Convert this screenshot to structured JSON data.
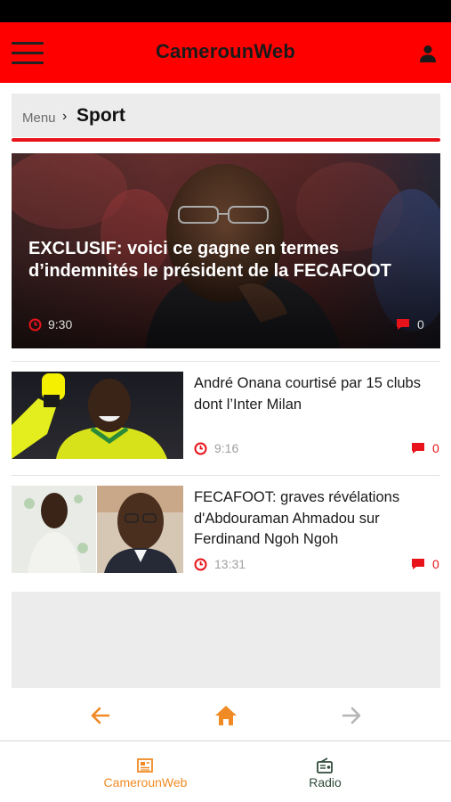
{
  "app": {
    "title": "CamerounWeb",
    "brand_color": "#ff0000",
    "accent_color": "#e8131a",
    "icons": [
      "hamburger-menu-icon",
      "user-icon",
      "clock-icon",
      "comment-icon",
      "arrow-left-icon",
      "home-icon",
      "arrow-right-icon",
      "newspaper-icon",
      "radio-icon"
    ]
  },
  "breadcrumb": {
    "menu_label": "Menu",
    "separator": "›",
    "current": "Sport"
  },
  "featured": {
    "title": "EXCLUSIF: voici ce gagne en termes d’indemnités le président de la FECAFOOT",
    "time": "9:30",
    "comments": "0"
  },
  "articles": [
    {
      "title": "André Onana courtisé par 15 clubs dont l’Inter Milan",
      "time": "9:16",
      "comments": "0"
    },
    {
      "title": "FECAFOOT: graves révélations d'Abdouraman Ahmadou sur Ferdinand Ngoh Ngoh",
      "time": "13:31",
      "comments": "0"
    }
  ],
  "nav": {
    "back_color": "#f08a24",
    "home_color": "#f08a24",
    "forward_color": "#b5b5b5"
  },
  "tabs": [
    {
      "label": "CamerounWeb",
      "color": "#f08a24",
      "active": true
    },
    {
      "label": "Radio",
      "color": "#2f4a3a",
      "active": false
    }
  ]
}
